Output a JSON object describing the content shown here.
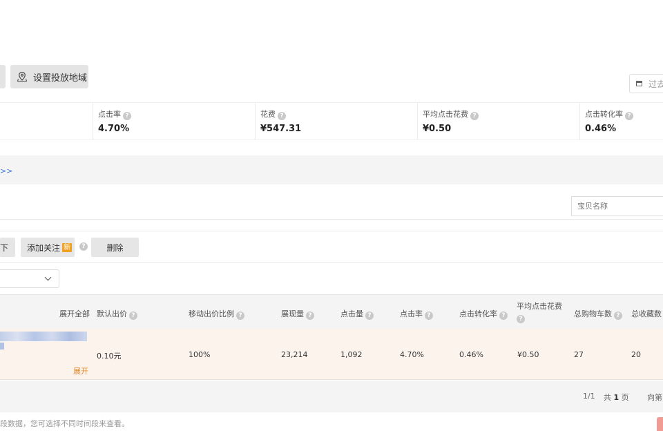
{
  "toolbar": {
    "region_button_label": "设置投放地域",
    "date_picker_text": "过去"
  },
  "metrics": [
    {
      "label": "点击率",
      "value": "4.70%"
    },
    {
      "label": "花费",
      "value": "¥547.31"
    },
    {
      "label": "平均点击花费",
      "value": "¥0.50"
    },
    {
      "label": "点击转化率",
      "value": "0.46%"
    }
  ],
  "band": {
    "link_text": ">>"
  },
  "search": {
    "placeholder": "宝贝名称"
  },
  "actions": {
    "stub_label": "下",
    "follow_label": "添加关注",
    "new_badge": "新",
    "delete_label": "删除"
  },
  "table": {
    "headers": {
      "expand_all": "展开全部",
      "default_bid": "默认出价",
      "mobile_ratio": "移动出价比例",
      "impressions": "展现量",
      "clicks": "点击量",
      "ctr": "点击率",
      "cvr": "点击转化率",
      "avg_cpc": "平均点击花费",
      "carts": "总购物车数",
      "favorites": "总收藏数"
    },
    "row": {
      "default_bid": "0.10元",
      "mobile_ratio": "100%",
      "impressions": "23,214",
      "clicks": "1,092",
      "ctr": "4.70%",
      "cvr": "0.46%",
      "avg_cpc": "¥0.50",
      "carts": "27",
      "favorites": "20",
      "expand": "展开"
    }
  },
  "pager": {
    "page": "1/1",
    "total_prefix": "共",
    "total_num": "1",
    "total_suffix": "页",
    "goto": "向第"
  },
  "footnote": "段数据，您可选择不同时间段来查看。"
}
